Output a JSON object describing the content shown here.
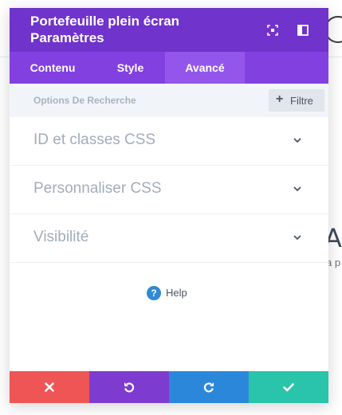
{
  "modal": {
    "title_line1": "Portefeuille plein écran",
    "title_line2": "Paramètres",
    "header_icons": [
      "expand-icon",
      "sidebar-layout-icon"
    ]
  },
  "tabs": [
    {
      "label": "Contenu",
      "active": false
    },
    {
      "label": "Style",
      "active": false
    },
    {
      "label": "Avancé",
      "active": true
    }
  ],
  "search": {
    "placeholder": "Options De Recherche",
    "filter_label": "Filtre",
    "filter_icon": "plus-icon"
  },
  "sections": [
    {
      "label": "ID et classes CSS",
      "icon": "chevron-down-icon"
    },
    {
      "label": "Personnaliser CSS",
      "icon": "chevron-down-icon"
    },
    {
      "label": "Visibilité",
      "icon": "chevron-down-icon"
    }
  ],
  "help": {
    "label": "Help",
    "icon": "question-circle-icon"
  },
  "footer": {
    "buttons": [
      {
        "name": "discard",
        "icon": "close-icon",
        "color": "#ef5555"
      },
      {
        "name": "undo",
        "icon": "undo-icon",
        "color": "#7e3bd0"
      },
      {
        "name": "redo",
        "icon": "redo-icon",
        "color": "#2b87da"
      },
      {
        "name": "save",
        "icon": "check-icon",
        "color": "#29c4a9"
      }
    ]
  },
  "background": {
    "heading_fragment": "Au",
    "sub_fragment": "a p"
  },
  "colors": {
    "header": "#7033cc",
    "tabs": "#8340e1",
    "tab_active": "#9456ea",
    "help_icon": "#2e8ad6"
  }
}
